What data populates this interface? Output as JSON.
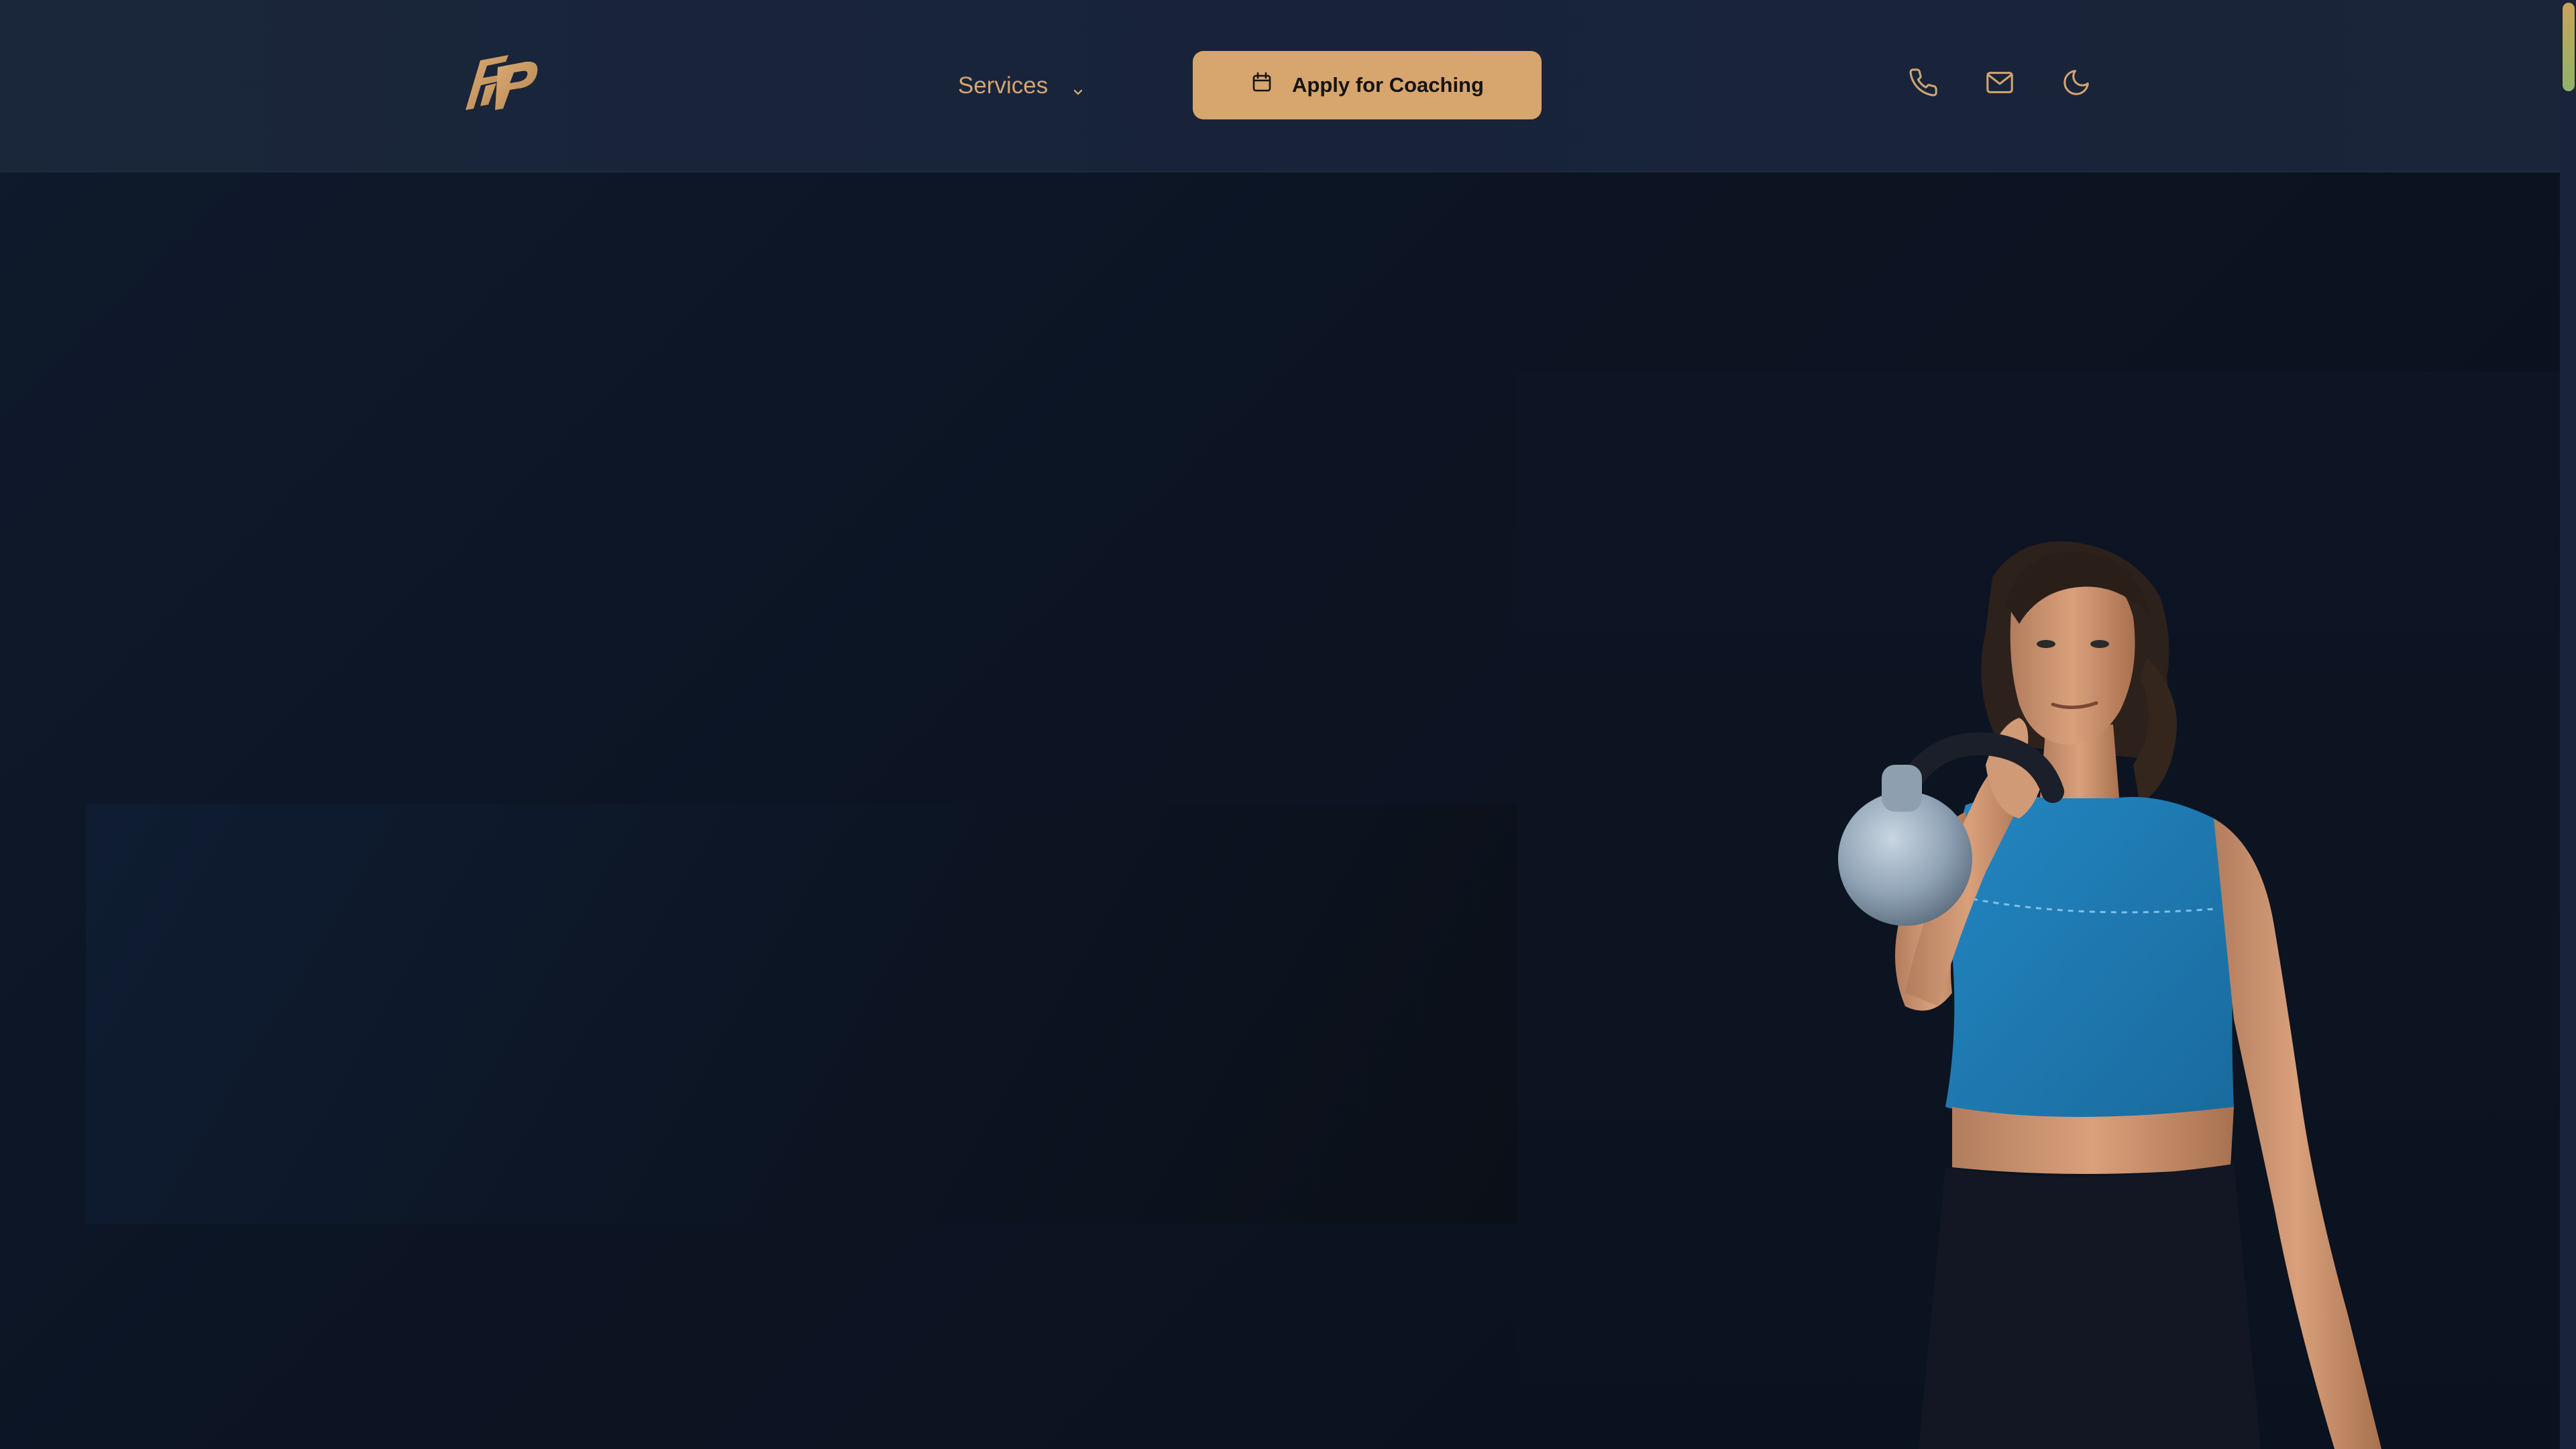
{
  "header": {
    "logo_alt": "FP",
    "nav": {
      "services_label": "Services"
    },
    "cta": {
      "label": "Apply for Coaching"
    },
    "icons": [
      "phone-icon",
      "mail-icon",
      "moon-icon"
    ]
  },
  "hero": {
    "image": "woman holding kettlebell in blue crop top"
  },
  "colors": {
    "accent": "#d7a56e",
    "header_bg": "#1a2639",
    "page_bg": "#0d1524",
    "shirt": "#1f7fb8"
  }
}
